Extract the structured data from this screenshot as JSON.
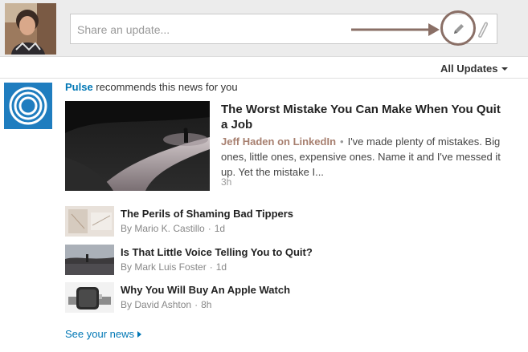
{
  "share": {
    "placeholder": "Share an update..."
  },
  "filter": {
    "label": "All Updates"
  },
  "recommendation": {
    "brand": "Pulse",
    "text": " recommends this news for you"
  },
  "featured": {
    "title": "The Worst Mistake You Can Make When You Quit a Job",
    "author": "Jeff Haden on LinkedIn",
    "dot": "•",
    "excerpt": "I've made plenty of mistakes. Big ones, little ones, expensive ones. Name it and I've messed it up. Yet the mistake I...",
    "time": "3h"
  },
  "news": [
    {
      "title": "The Perils of Shaming Bad Tippers",
      "author": "By Mario K. Castillo",
      "sep": "·",
      "time": "1d"
    },
    {
      "title": "Is That Little Voice Telling You to Quit?",
      "author": "By Mark Luis Foster",
      "sep": "·",
      "time": "1d"
    },
    {
      "title": "Why You Will Buy An Apple Watch",
      "author": "By David Ashton",
      "sep": "·",
      "time": "8h"
    }
  ],
  "footer": {
    "see_news": "See your news"
  },
  "icons": {
    "pencil": "pencil-icon",
    "attach": "paperclip-icon",
    "pulse": "pulse-logo"
  },
  "colors": {
    "link": "#0077b5",
    "author": "#a77f6f",
    "pulse_bg": "#1f7dbf"
  }
}
